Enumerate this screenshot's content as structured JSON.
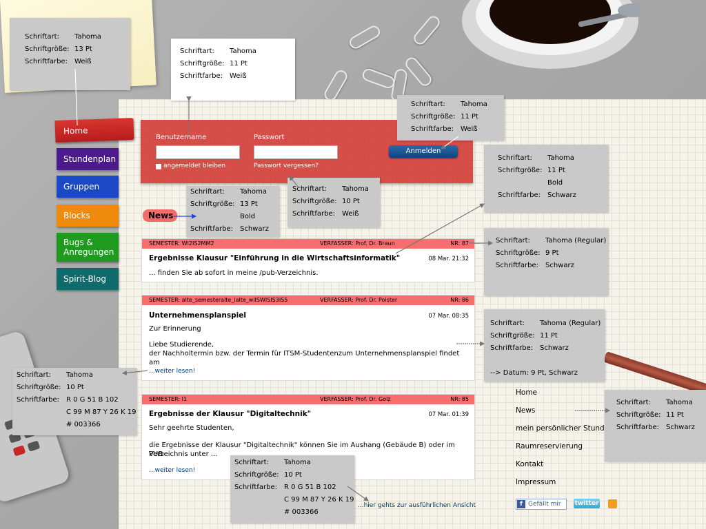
{
  "nav": {
    "home": "Home",
    "stundenplan": "Stundenplan",
    "gruppen": "Gruppen",
    "blocks": "Blocks",
    "bugs": "Bugs &\nAnregungen",
    "spirit": "Spirit-Blog"
  },
  "colors": {
    "home": "#c62828",
    "stundenplan": "#4b1a8c",
    "gruppen": "#1b48c7",
    "blocks": "#ef8b0c",
    "bugs": "#1f9a1f",
    "spirit": "#0f6b6b"
  },
  "login": {
    "username_label": "Benutzername",
    "password_label": "Passwort",
    "remember": "angemeldet bleiben",
    "forgot": "Passwort vergessen?",
    "submit": "Anmelden"
  },
  "news": {
    "title": "News",
    "posts": [
      {
        "semester": "SEMESTER:  WI2IS2MM2",
        "author": "VERFASSER: Prof. Dr. Braun",
        "nr": "NR: 87",
        "title": "Ergebnisse Klausur \"Einführung in die Wirtschaftsinformatik\"",
        "date": "08 Mar. 21:32",
        "text1": "... finden Sie ab sofort in meine /pub-Verzeichnis.",
        "text2": "",
        "text3": "",
        "more": ""
      },
      {
        "semester": "SEMESTER: alte_semesteralte_ialte_wiISWISIS3IS5",
        "author": "VERFASSER: Prof. Dr. Polster",
        "nr": "NR: 86",
        "title": "Unternehmensplanspiel",
        "date": "07 Mar. 08:35",
        "text1": "Zur Erinnerung",
        "text2": "Liebe Studierende,",
        "text3": "der Nachholtermin bzw. der Termin für ITSM-Studentenzum Unternehmensplanspiel findet am",
        "more": "...weiter lesen!"
      },
      {
        "semester": "SEMESTER:  I1",
        "author": "VERFASSER: Prof. Dr. Golz",
        "nr": "NR: 85",
        "title": "Ergebnisse der Klausur \"Digitaltechnik\"",
        "date": "07 Mar. 01:39",
        "text1": "Sehr geehrte Studenten,",
        "text2": "die Ergebnisse der Klausur \"Digitaltechnik\" können Sie im Aushang (Gebäude B) oder im PUB-",
        "text3": "Verzeichnis unter ...",
        "more": "...weiter lesen!"
      }
    ],
    "detail_link": "...hier gehts zur ausführlichen Ansicht"
  },
  "footer": {
    "links": [
      "Home",
      "News",
      "mein persönlicher Stunden",
      "Raumreservierung",
      "Kontakt",
      "Impressum"
    ],
    "facebook": "Gefällt mir",
    "twitter": "twitter"
  },
  "annotations": {
    "l_font": "Schriftart:",
    "l_size": "Schriftgröße:",
    "l_color": "Schriftfarbe:",
    "a1": {
      "font": "Tahoma",
      "size": "13 Pt",
      "color": "Weiß"
    },
    "a2": {
      "font": "Tahoma",
      "size": "11 Pt",
      "color": "Weiß"
    },
    "a3": {
      "font": "Tahoma",
      "size": "11 Pt",
      "color": "Weiß"
    },
    "a4": {
      "font": "Tahoma",
      "size": "11 Pt",
      "extra": "Bold",
      "color": "Schwarz"
    },
    "a5": {
      "font": "Tahoma",
      "size": "13 Pt",
      "extra": "Bold",
      "color": "Schwarz"
    },
    "a6": {
      "font": "Tahoma",
      "size": "10 Pt",
      "color": "Weiß"
    },
    "a7": {
      "font": "Tahoma (Regular)",
      "size": "9 Pt",
      "color": "Schwarz"
    },
    "a8": {
      "font": "Tahoma (Regular)",
      "size": "11 Pt",
      "color": "Schwarz",
      "note": "--> Datum: 9 Pt, Schwarz"
    },
    "a9": {
      "font": "Tahoma",
      "size": "10 Pt",
      "color1": "R 0 G 51 B 102",
      "color2": "C 99 M 87 Y 26 K 19",
      "color3": "# 003366"
    },
    "a10": {
      "font": "Tahoma",
      "size": "10 Pt",
      "color1": "R 0 G 51 B 102",
      "color2": "C 99 M 87 Y 26 K 19",
      "color3": "# 003366"
    },
    "a11": {
      "font": "Tahoma",
      "size": "11 Pt",
      "color": "Schwarz"
    }
  }
}
